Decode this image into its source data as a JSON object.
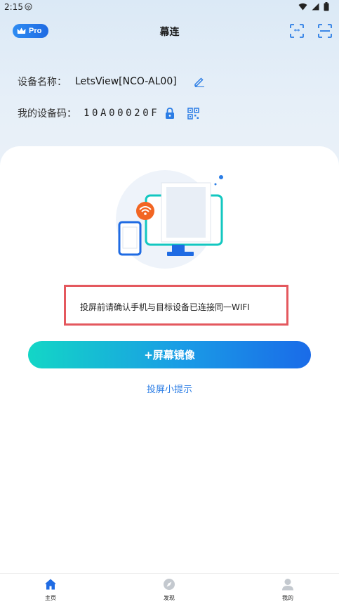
{
  "status_bar": {
    "time": "2:15"
  },
  "header": {
    "pro_label": "Pro",
    "title": "幕连"
  },
  "device": {
    "name_label": "设备名称：",
    "name_value": "LetsView[NCO-AL00]",
    "code_label": "我的设备码：",
    "code_value": "10A00020F"
  },
  "main": {
    "notice_text": "投屏前请确认手机与目标设备已连接同一WIFI",
    "mirror_button_label": "+屏幕镜像",
    "tips_link": "投屏小提示"
  },
  "bottom_nav": {
    "items": [
      {
        "label": "主页",
        "icon": "home-icon",
        "active": true
      },
      {
        "label": "发现",
        "icon": "compass-icon",
        "active": false
      },
      {
        "label": "我的",
        "icon": "user-icon",
        "active": false
      }
    ]
  },
  "colors": {
    "accent": "#1a6be8",
    "gradient_start": "#13d6c6",
    "notice_border": "#e4585e",
    "link": "#2b7de5"
  }
}
